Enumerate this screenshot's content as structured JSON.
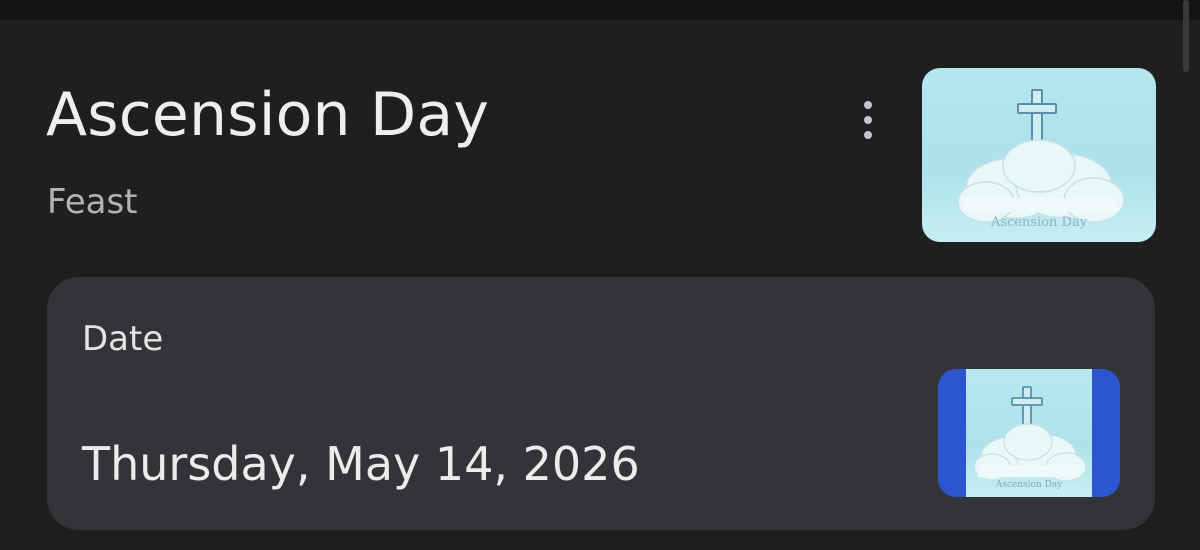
{
  "event": {
    "title": "Ascension Day",
    "type": "Feast"
  },
  "menu": {
    "icon": "more-vert-icon"
  },
  "image": {
    "caption": "Ascension Day",
    "bg_color": "#b4e6ee"
  },
  "date_card": {
    "label": "Date",
    "value": "Thursday, May 14, 2026",
    "bg_color": "#333438"
  },
  "colors": {
    "background": "#1f1f20",
    "accent_blue": "#2c56cf"
  }
}
